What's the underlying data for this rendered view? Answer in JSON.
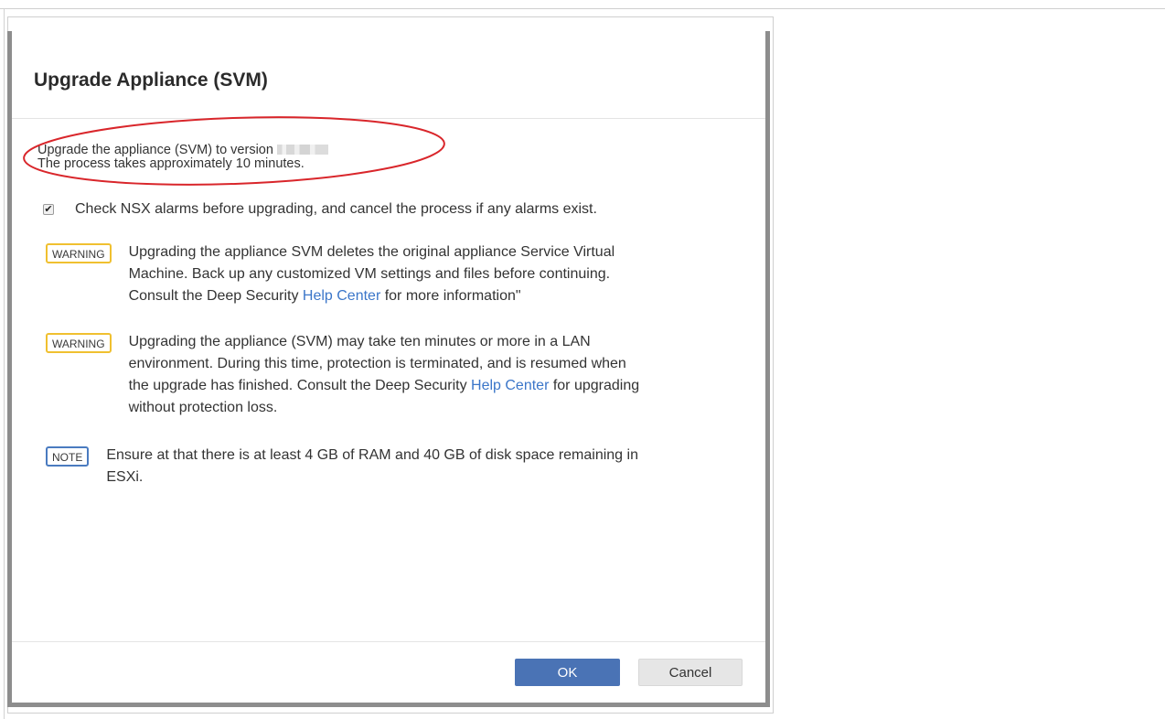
{
  "dialog": {
    "title": "Upgrade Appliance (SVM)",
    "intro_line1": "Upgrade the appliance (SVM) to version",
    "intro_line2": "The process takes approximately 10 minutes.",
    "check_nsx_label": "Check NSX alarms before upgrading, and cancel the process if any alarms exist.",
    "check_nsx_checked": true,
    "warning1": {
      "badge": "WARNING",
      "line1": "Upgrading the appliance SVM deletes the original appliance Service Virtual",
      "line2": "Machine. Back up any customized VM settings and files before continuing.",
      "line3_prefix": "Consult the Deep Security ",
      "line3_link": "Help Center",
      "line3_suffix": " for more information\""
    },
    "warning2": {
      "badge": "WARNING",
      "line1": "Upgrading the appliance (SVM) may take ten minutes or more in a LAN",
      "line2": "environment. During this time, protection is terminated, and is resumed when",
      "line3_prefix": "the upgrade has finished. Consult the Deep Security ",
      "line3_link": "Help Center",
      "line3_suffix": " for upgrading",
      "line4": "without protection loss."
    },
    "note": {
      "badge": "NOTE",
      "line1": "Ensure at that there is at least 4 GB of RAM and 40 GB of disk space remaining in",
      "line2": "ESXi."
    },
    "ok_label": "OK",
    "cancel_label": "Cancel"
  },
  "colors": {
    "accent_button": "#4a73b5",
    "link": "#3b76c9",
    "warning_badge_border": "#f0c030",
    "note_badge_border": "#4a7bc0",
    "annotation_ellipse": "#d9262b"
  }
}
